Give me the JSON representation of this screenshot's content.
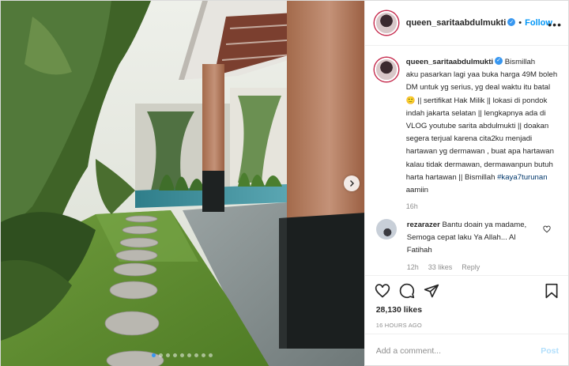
{
  "post": {
    "username": "queen_saritaabdulmukti",
    "separator": "•",
    "follow_label": "Follow",
    "more_label": "•••",
    "caption": {
      "username": "queen_saritaabdulmukti",
      "text_before_tag": "Bismillah\naku pasarkan lagi yaa buka harga 49M boleh DM untuk yg serius, yg deal waktu itu batal 🙂 || sertifikat Hak Milik || lokasi di pondok indah jakarta selatan || lengkapnya ada di VLOG youtube sarita abdulmukti || doakan segera terjual karena cita2ku menjadi hartawan yg dermawan , buat apa hartawan kalau tidak dermawan, dermawanpun butuh harta hartawan || Bismillah ",
      "hashtag": "#kaya7turunan",
      "text_after_tag": " aamiin",
      "time": "16h"
    },
    "comment": {
      "username": "rezarazer",
      "text": "Bantu doain ya madame, Semoga cepat laku Ya Allah... Al Fatihah",
      "time": "12h",
      "likes": "33 likes",
      "reply": "Reply"
    },
    "likes": "28,130 likes",
    "date": "16 HOURS AGO",
    "add_comment_placeholder": "Add a comment...",
    "post_label": "Post"
  },
  "icons": {
    "verified": "verified-badge-icon",
    "next": "chevron-right-icon",
    "heart": "heart-icon",
    "comment": "comment-icon",
    "share": "paper-plane-icon",
    "save": "bookmark-icon"
  },
  "carousel": {
    "slides": 9,
    "active": 1
  },
  "colors": {
    "accent": "#0095f6",
    "verified": "#3897f0",
    "muted": "#8e8e8e",
    "active_dot": "#3897f0"
  }
}
